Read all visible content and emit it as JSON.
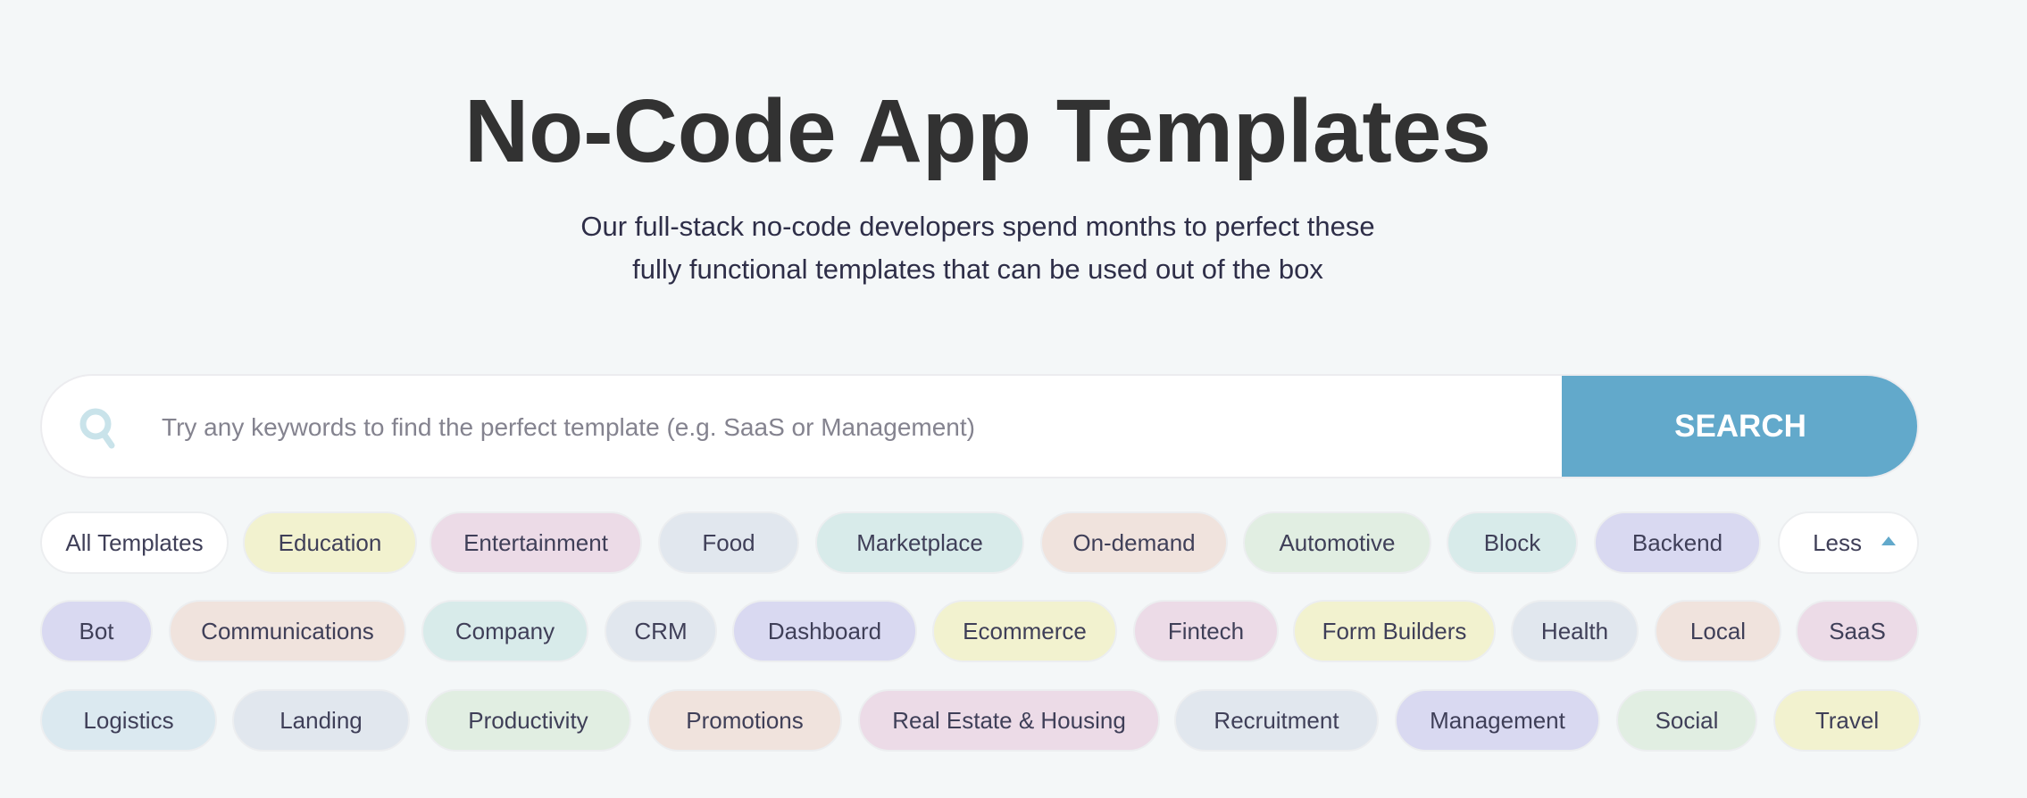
{
  "header": {
    "title": "No-Code App Templates",
    "subtitle_line1": "Our full-stack no-code developers spend months to perfect these",
    "subtitle_line2": "fully functional templates that can be used out of the box"
  },
  "search": {
    "placeholder": "Try any keywords to find the perfect template (e.g. SaaS or Management)",
    "value": "",
    "button_label": "SEARCH",
    "accent": "#62a9cb"
  },
  "categories": {
    "rows": [
      [
        {
          "label": "All Templates",
          "color": "#ffffff"
        },
        {
          "label": "Education",
          "color": "#f2f2cf"
        },
        {
          "label": "Entertainment",
          "color": "#ecdbe7"
        },
        {
          "label": "Food",
          "color": "#e1e7ee"
        },
        {
          "label": "Marketplace",
          "color": "#d8ebea"
        },
        {
          "label": "On-demand",
          "color": "#f0e3dd"
        },
        {
          "label": "Automotive",
          "color": "#e1eee2"
        },
        {
          "label": "Block",
          "color": "#d8ebea"
        },
        {
          "label": "Backend",
          "color": "#d9d9f1"
        },
        {
          "label": "Less",
          "color": "#ffffff",
          "toggle": true
        }
      ],
      [
        {
          "label": "Bot",
          "color": "#d9d9f1"
        },
        {
          "label": "Communications",
          "color": "#f0e3dd"
        },
        {
          "label": "Company",
          "color": "#d8ebea"
        },
        {
          "label": "CRM",
          "color": "#e1e7ee"
        },
        {
          "label": "Dashboard",
          "color": "#d9d9f1"
        },
        {
          "label": "Ecommerce",
          "color": "#f2f2cf"
        },
        {
          "label": "Fintech",
          "color": "#ecdbe7"
        },
        {
          "label": "Form Builders",
          "color": "#f2f2cf"
        },
        {
          "label": "Health",
          "color": "#e1e7ee"
        },
        {
          "label": "Local",
          "color": "#f0e3dd"
        },
        {
          "label": "SaaS",
          "color": "#ecdbe7"
        }
      ],
      [
        {
          "label": "Logistics",
          "color": "#dbe9f0"
        },
        {
          "label": "Landing",
          "color": "#e1e7ee"
        },
        {
          "label": "Productivity",
          "color": "#e1eee2"
        },
        {
          "label": "Promotions",
          "color": "#f0e3dd"
        },
        {
          "label": "Real Estate & Housing",
          "color": "#ecdbe7"
        },
        {
          "label": "Recruitment",
          "color": "#e1e7ee"
        },
        {
          "label": "Management",
          "color": "#d9d9f1"
        },
        {
          "label": "Social",
          "color": "#e1eee2"
        },
        {
          "label": "Travel",
          "color": "#f2f2cf"
        }
      ]
    ]
  }
}
